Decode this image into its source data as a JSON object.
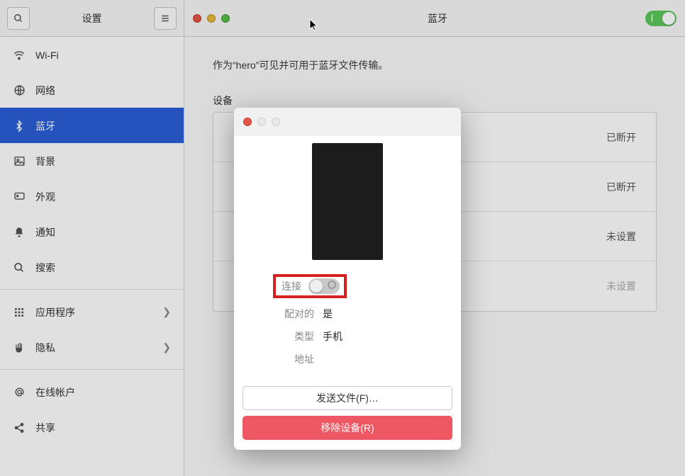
{
  "sidebar": {
    "title": "设置",
    "items": [
      {
        "icon": "wifi",
        "label": "Wi-Fi"
      },
      {
        "icon": "globe",
        "label": "网络"
      },
      {
        "icon": "bluetooth",
        "label": "蓝牙",
        "selected": true
      },
      {
        "icon": "image",
        "label": "背景"
      },
      {
        "icon": "appearance",
        "label": "外观"
      },
      {
        "icon": "bell",
        "label": "通知"
      },
      {
        "icon": "search",
        "label": "搜索"
      },
      {
        "icon": "apps",
        "label": "应用程序",
        "chevron": true
      },
      {
        "icon": "hand",
        "label": "隐私",
        "chevron": true
      },
      {
        "icon": "at",
        "label": "在线帐户"
      },
      {
        "icon": "share",
        "label": "共享"
      }
    ]
  },
  "main": {
    "title": "蓝牙",
    "visibility_text": "作为“hero”可见并可用于蓝牙文件传输。",
    "devices_label": "设备",
    "device_statuses": [
      "已断开",
      "已断开",
      "未设置",
      "未设置"
    ]
  },
  "modal": {
    "props": {
      "connect_label": "连接",
      "paired_label": "配对的",
      "paired_value": "是",
      "type_label": "类型",
      "type_value": "手机",
      "address_label": "地址"
    },
    "send_files": "发送文件(F)…",
    "remove_device": "移除设备(R)"
  }
}
